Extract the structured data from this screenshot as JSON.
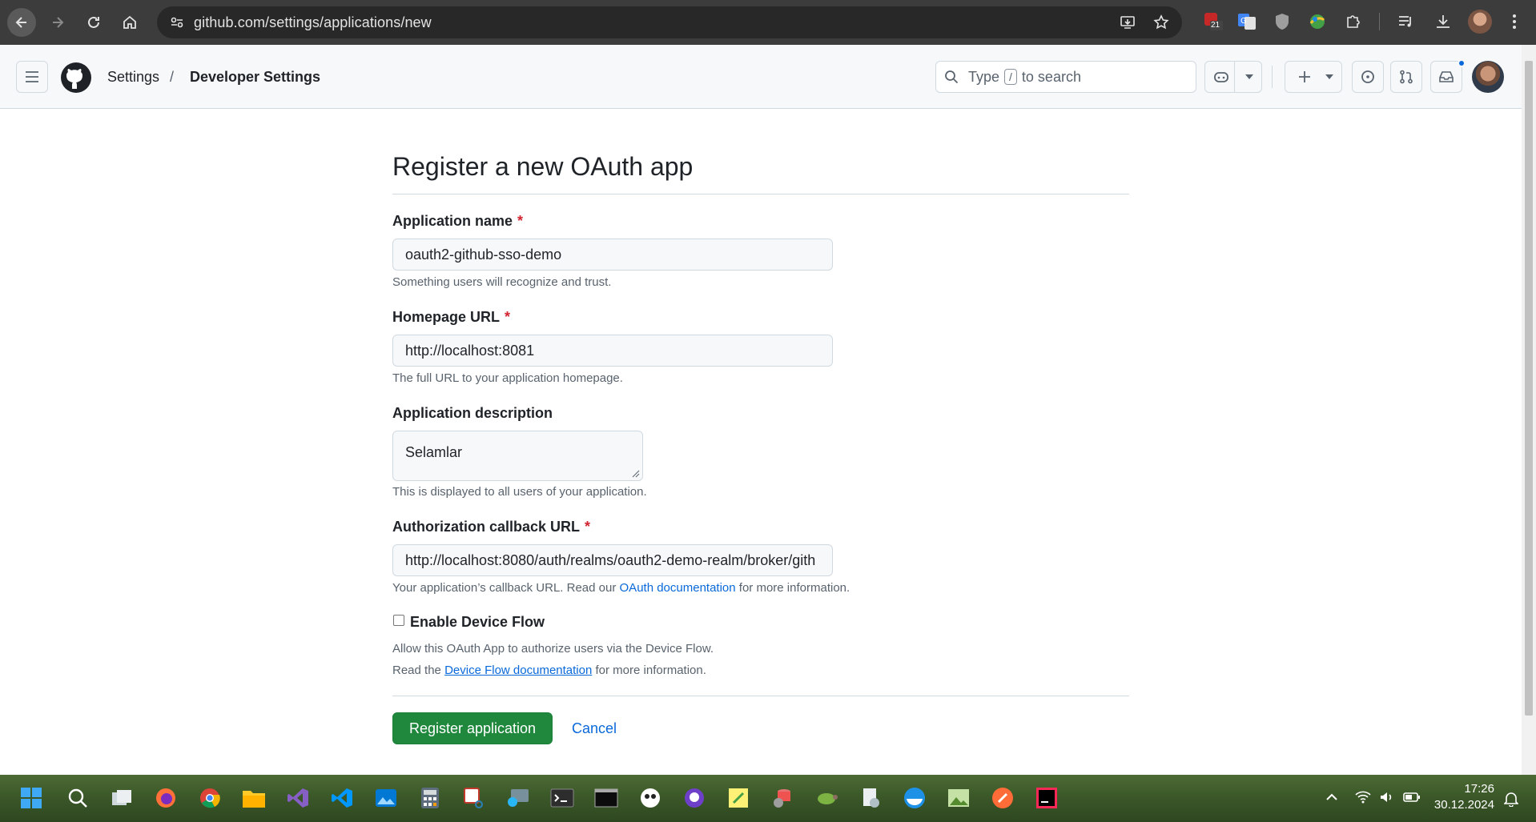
{
  "browser": {
    "url": "github.com/settings/applications/new",
    "extension_badge": "21",
    "icons": [
      "back-icon",
      "forward-icon",
      "reload-icon",
      "home-icon",
      "tune-icon",
      "install-app-icon",
      "bookmark-star-icon",
      "extension-icon",
      "translate-icon",
      "shield-icon",
      "puzzle-icon",
      "media-icon",
      "download-icon",
      "profile-icon",
      "kebab-icon"
    ]
  },
  "header": {
    "breadcrumb_settings": "Settings",
    "breadcrumb_separator": "/",
    "breadcrumb_developer": "Developer Settings",
    "search_prefix": "Type",
    "search_key": "/",
    "search_suffix": "to search"
  },
  "form": {
    "title": "Register a new OAuth app",
    "required_mark": "*",
    "app_name_label": "Application name",
    "app_name_value": "oauth2-github-sso-demo",
    "app_name_note": "Something users will recognize and trust.",
    "homepage_label": "Homepage URL",
    "homepage_value": "http://localhost:8081",
    "homepage_note": "The full URL to your application homepage.",
    "description_label": "Application description",
    "description_value": "Selamlar",
    "description_note": "This is displayed to all users of your application.",
    "callback_label": "Authorization callback URL",
    "callback_value": "http://localhost:8080/auth/realms/oauth2-demo-realm/broker/gith",
    "callback_note_prefix": "Your application’s callback URL. Read our",
    "callback_note_link": "OAuth documentation",
    "callback_note_suffix": "for more information.",
    "device_flow_label": "Enable Device Flow",
    "device_flow_checked": false,
    "device_flow_note1": "Allow this OAuth App to authorize users via the Device Flow.",
    "device_flow_note2_prefix": "Read the",
    "device_flow_note2_link": "Device Flow documentation",
    "device_flow_note2_suffix": "for more information.",
    "register_button": "Register application",
    "cancel_link": "Cancel"
  },
  "taskbar": {
    "time": "17:26",
    "date": "30.12.2024"
  },
  "colors": {
    "accent_green": "#1f883d",
    "link_blue": "#0969da",
    "required_red": "#d1242f"
  }
}
